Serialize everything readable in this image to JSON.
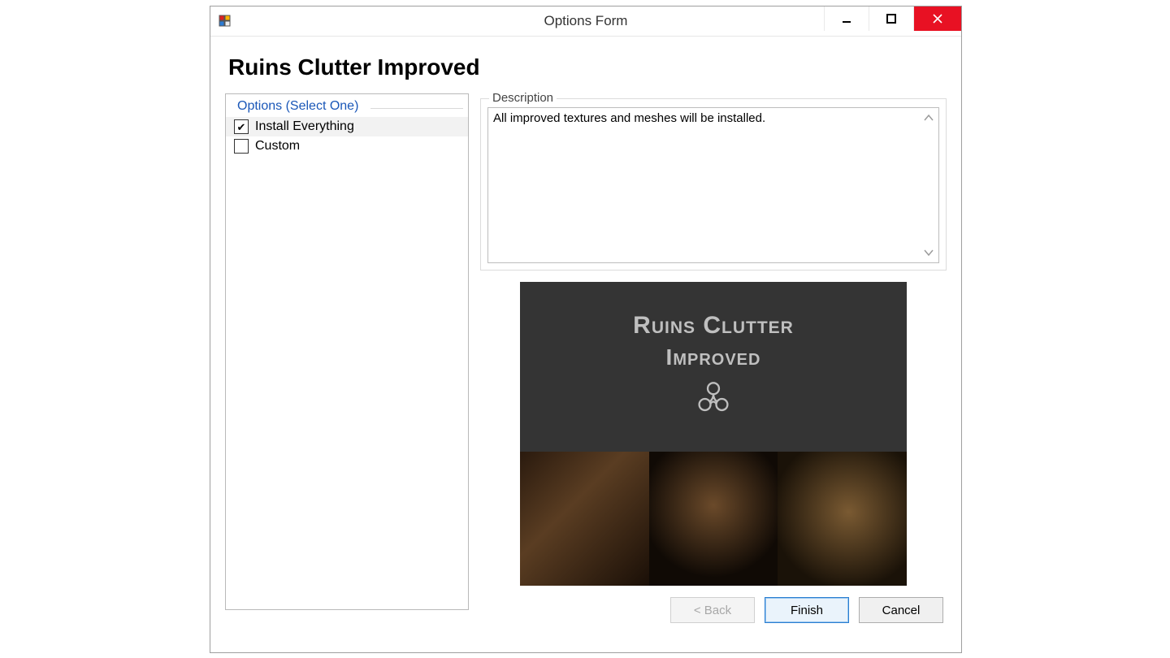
{
  "window": {
    "title": "Options Form"
  },
  "page": {
    "heading": "Ruins Clutter Improved"
  },
  "options": {
    "header": "Options (Select One)",
    "items": [
      {
        "label": "Install Everything",
        "checked": true,
        "selected": true
      },
      {
        "label": "Custom",
        "checked": false,
        "selected": false
      }
    ]
  },
  "description": {
    "legend": "Description",
    "text": "All improved textures and meshes will be installed."
  },
  "preview": {
    "line1": "Ruins Clutter",
    "line2": "Improved"
  },
  "buttons": {
    "back": "< Back",
    "finish": "Finish",
    "cancel": "Cancel"
  }
}
